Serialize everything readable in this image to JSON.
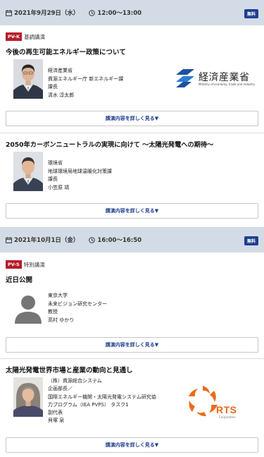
{
  "days": [
    {
      "date": "2021年9月29日（水）",
      "time": "12:00〜13:00",
      "badge": "無料",
      "category_tag": "PV-K",
      "category_label": "基調講演",
      "sessions": [
        {
          "title": "今後の再生可能エネルギー政策について",
          "speaker_lines": [
            "経済産業省",
            "資源エネルギー庁 新エネルギー課",
            "課長",
            "清水 淳太郎"
          ],
          "logo_text": "経済産業省",
          "logo_sub": "Ministry of economy, trade and industry",
          "button": "講演内容を詳しく見る▼"
        },
        {
          "title": "2050年カーボンニュートラルの実現に向けて 〜太陽光発電への期待〜",
          "speaker_lines": [
            "環境省",
            "地球環境局地球温暖化対策課",
            "課長",
            "小笠原 靖"
          ],
          "button": "講演内容を詳しく見る▼"
        }
      ]
    },
    {
      "date": "2021年10月1日（金）",
      "time": "16:00〜16:50",
      "badge": "無料",
      "category_tag": "PV-S",
      "category_label": "特別講演",
      "sessions": [
        {
          "title": "近日公開",
          "speaker_lines": [
            "東京大学",
            "未来ビジョン研究センター",
            "教授",
            "高村 ゆかり"
          ],
          "button": "講演内容を詳しく見る▼"
        },
        {
          "title": "太陽光発電世界市場と産業の動向と見通し",
          "speaker_lines": [
            "（株）資源総合システム",
            "企画部長／",
            "国際エネルギー機関・太陽光発電システム研究協",
            "力プログラム（IEA PVPS） タスク1",
            "副代表",
            "貝塚 泉"
          ],
          "logo_text": "RTS",
          "logo_sub": "Corporation",
          "button": "講演内容を詳しく見る▼"
        }
      ]
    }
  ],
  "colors": {
    "header_bg": "#d3dce6",
    "badge_bg": "#1f3f8f",
    "tag_bg": "#b71c2a",
    "link": "#1e3e8e",
    "meti_blue": "#1f4f9e",
    "rts_orange": "#ec6a1c"
  }
}
